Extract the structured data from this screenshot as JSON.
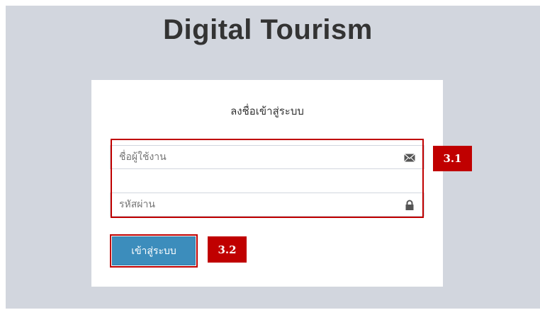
{
  "app": {
    "title": "Digital Tourism"
  },
  "login": {
    "heading": "ลงชื่อเข้าสู่ระบบ",
    "username": {
      "placeholder": "ชื่อผู้ใช้งาน",
      "value": "",
      "icon": "envelope-icon"
    },
    "password": {
      "placeholder": "รหัสผ่าน",
      "value": "",
      "icon": "lock-icon"
    },
    "submit_label": "เข้าสู่ระบบ"
  },
  "annotations": {
    "fields_label": "3.1",
    "button_label": "3.2"
  },
  "colors": {
    "background": "#d2d6de",
    "accent": "#3c8dbc",
    "highlight": "#c00000"
  }
}
